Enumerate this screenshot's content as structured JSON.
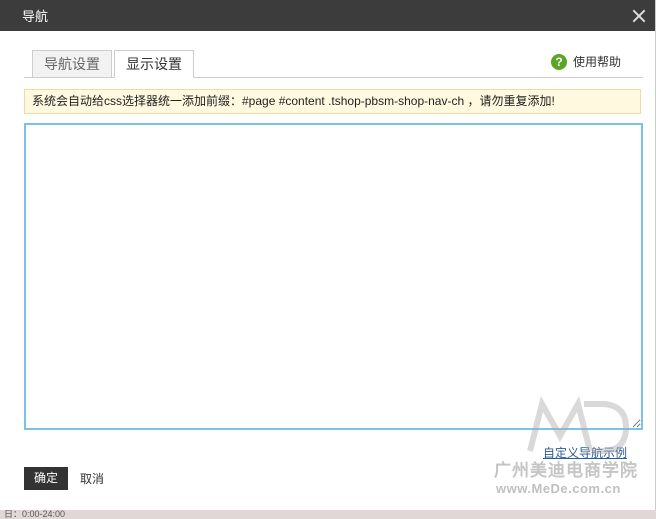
{
  "dialog": {
    "title": "导航",
    "close_icon": "close-icon"
  },
  "tabs": [
    {
      "label": "导航设置",
      "active": false
    },
    {
      "label": "显示设置",
      "active": true
    }
  ],
  "help": {
    "icon": "question-icon",
    "label": "使用帮助",
    "icon_color": "#5aa526"
  },
  "notice": {
    "text": "系统会自动给css选择器统一添加前缀：#page #content .tshop-pbsm-shop-nav-ch ，请勿重复添加!"
  },
  "editor": {
    "value": ""
  },
  "links": {
    "example": "自定义导航示例"
  },
  "buttons": {
    "ok": "确定",
    "cancel": "取消"
  },
  "watermark": {
    "name": "广州美迪电商学院",
    "url": "www.MeDe.com.cn"
  },
  "backdrop": {
    "bottom_text": "日：0:00-24:00"
  },
  "colors": {
    "titlebar": "#3c3c3c",
    "editor_border": "#7bc2e6",
    "notice_bg": "#fff9e0",
    "link": "#2a5b9a"
  }
}
